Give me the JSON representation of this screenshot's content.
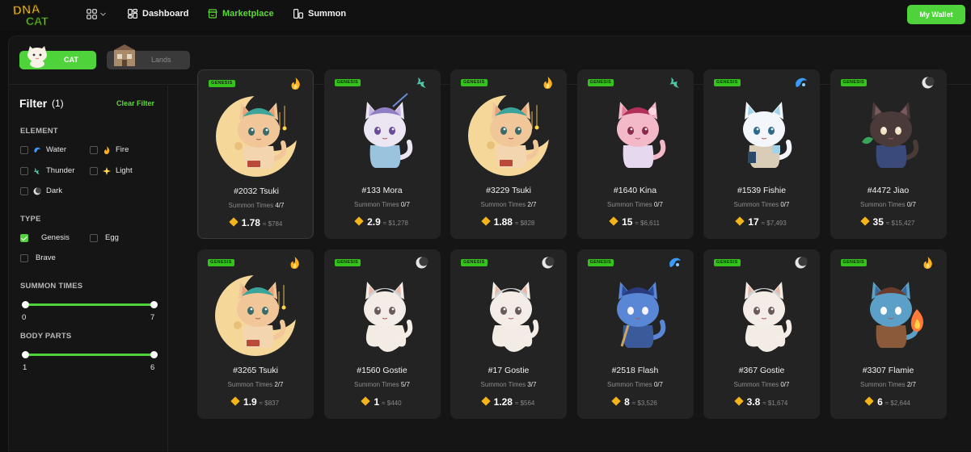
{
  "brand": {
    "logo_top": "DNA",
    "logo_bottom": "CAT"
  },
  "nav": {
    "dashboard": "Dashboard",
    "marketplace": "Marketplace",
    "summon": "Summon",
    "wallet": "My Wallet"
  },
  "tabs": {
    "cat": "CAT",
    "lands": "Lands"
  },
  "filter": {
    "title": "Filter",
    "count": "(1)",
    "clear": "Clear Filter",
    "element_label": "ELEMENT",
    "elements": [
      {
        "label": "Water",
        "checked": false,
        "icon": "water-icon"
      },
      {
        "label": "Fire",
        "checked": false,
        "icon": "fire-icon"
      },
      {
        "label": "Thunder",
        "checked": false,
        "icon": "thunder-icon"
      },
      {
        "label": "Light",
        "checked": false,
        "icon": "light-icon"
      },
      {
        "label": "Dark",
        "checked": false,
        "icon": "dark-icon"
      }
    ],
    "type_label": "TYPE",
    "types": [
      {
        "label": "Genesis",
        "checked": true
      },
      {
        "label": "Egg",
        "checked": false
      },
      {
        "label": "Brave",
        "checked": false
      }
    ],
    "summon_label": "SUMMON TIMES",
    "summon_min": "0",
    "summon_max": "7",
    "body_label": "BODY PARTS",
    "body_min": "1",
    "body_max": "6"
  },
  "cards": [
    {
      "badge": "GENESIS",
      "element": "fire",
      "art": "tsuki",
      "name": "#2032 Tsuki",
      "summon_label": "Summon Times",
      "summon": "4/7",
      "price": "1.78",
      "usd": "≈ $784"
    },
    {
      "badge": "GENESIS",
      "element": "thunder",
      "art": "mora",
      "name": "#133 Mora",
      "summon_label": "Summon Times",
      "summon": "0/7",
      "price": "2.9",
      "usd": "≈ $1,278"
    },
    {
      "badge": "GENESIS",
      "element": "fire",
      "art": "tsuki",
      "name": "#3229 Tsuki",
      "summon_label": "Summon Times",
      "summon": "2/7",
      "price": "1.88",
      "usd": "≈ $828"
    },
    {
      "badge": "GENESIS",
      "element": "thunder",
      "art": "kina",
      "name": "#1640 Kina",
      "summon_label": "Summon Times",
      "summon": "0/7",
      "price": "15",
      "usd": "≈ $6,611"
    },
    {
      "badge": "GENESIS",
      "element": "water",
      "art": "fishie",
      "name": "#1539 Fishie",
      "summon_label": "Summon Times",
      "summon": "0/7",
      "price": "17",
      "usd": "≈ $7,493"
    },
    {
      "badge": "GENESIS",
      "element": "dark",
      "art": "jiao",
      "name": "#4472 Jiao",
      "summon_label": "Summon Times",
      "summon": "0/7",
      "price": "35",
      "usd": "≈ $15,427"
    },
    {
      "badge": "GENESIS",
      "element": "fire",
      "art": "tsuki",
      "name": "#3265 Tsuki",
      "summon_label": "Summon Times",
      "summon": "2/7",
      "price": "1.9",
      "usd": "≈ $837"
    },
    {
      "badge": "GENESIS",
      "element": "dark",
      "art": "gostie",
      "name": "#1560 Gostie",
      "summon_label": "Summon Times",
      "summon": "5/7",
      "price": "1",
      "usd": "≈ $440"
    },
    {
      "badge": "GENESIS",
      "element": "dark",
      "art": "gostie",
      "name": "#17 Gostie",
      "summon_label": "Summon Times",
      "summon": "3/7",
      "price": "1.28",
      "usd": "≈ $564"
    },
    {
      "badge": "GENESIS",
      "element": "water",
      "art": "flash",
      "name": "#2518 Flash",
      "summon_label": "Summon Times",
      "summon": "0/7",
      "price": "8",
      "usd": "≈ $3,526"
    },
    {
      "badge": "GENESIS",
      "element": "dark",
      "art": "gostie",
      "name": "#367 Gostie",
      "summon_label": "Summon Times",
      "summon": "0/7",
      "price": "3.8",
      "usd": "≈ $1,674"
    },
    {
      "badge": "GENESIS",
      "element": "fire",
      "art": "flamie",
      "name": "#3307 Flamie",
      "summon_label": "Summon Times",
      "summon": "2/7",
      "price": "6",
      "usd": "≈ $2,644"
    }
  ],
  "colors": {
    "accent": "#4fd33a",
    "background": "#0f0f0f",
    "card": "#232323",
    "price_icon": "#f5b419"
  }
}
